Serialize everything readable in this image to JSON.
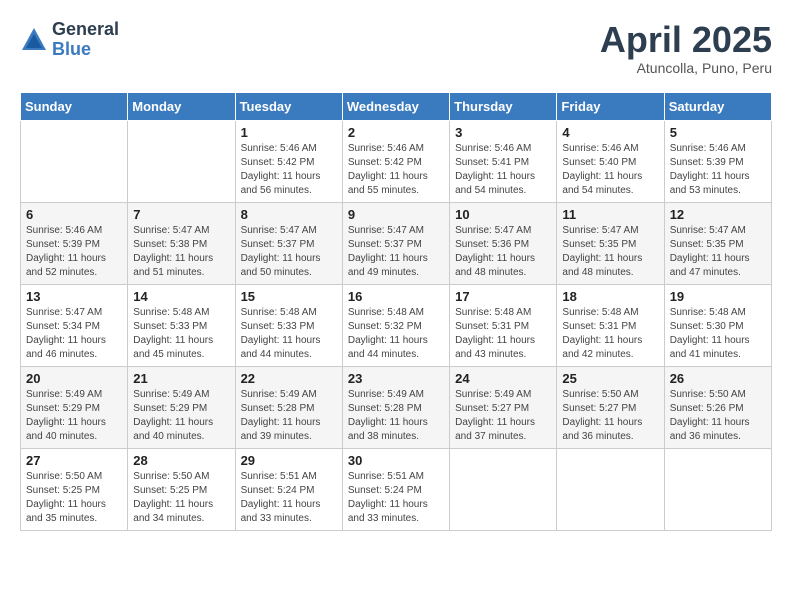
{
  "header": {
    "logo_general": "General",
    "logo_blue": "Blue",
    "month_title": "April 2025",
    "subtitle": "Atuncolla, Puno, Peru"
  },
  "days_of_week": [
    "Sunday",
    "Monday",
    "Tuesday",
    "Wednesday",
    "Thursday",
    "Friday",
    "Saturday"
  ],
  "weeks": [
    [
      {
        "day": "",
        "info": ""
      },
      {
        "day": "",
        "info": ""
      },
      {
        "day": "1",
        "info": "Sunrise: 5:46 AM\nSunset: 5:42 PM\nDaylight: 11 hours and 56 minutes."
      },
      {
        "day": "2",
        "info": "Sunrise: 5:46 AM\nSunset: 5:42 PM\nDaylight: 11 hours and 55 minutes."
      },
      {
        "day": "3",
        "info": "Sunrise: 5:46 AM\nSunset: 5:41 PM\nDaylight: 11 hours and 54 minutes."
      },
      {
        "day": "4",
        "info": "Sunrise: 5:46 AM\nSunset: 5:40 PM\nDaylight: 11 hours and 54 minutes."
      },
      {
        "day": "5",
        "info": "Sunrise: 5:46 AM\nSunset: 5:39 PM\nDaylight: 11 hours and 53 minutes."
      }
    ],
    [
      {
        "day": "6",
        "info": "Sunrise: 5:46 AM\nSunset: 5:39 PM\nDaylight: 11 hours and 52 minutes."
      },
      {
        "day": "7",
        "info": "Sunrise: 5:47 AM\nSunset: 5:38 PM\nDaylight: 11 hours and 51 minutes."
      },
      {
        "day": "8",
        "info": "Sunrise: 5:47 AM\nSunset: 5:37 PM\nDaylight: 11 hours and 50 minutes."
      },
      {
        "day": "9",
        "info": "Sunrise: 5:47 AM\nSunset: 5:37 PM\nDaylight: 11 hours and 49 minutes."
      },
      {
        "day": "10",
        "info": "Sunrise: 5:47 AM\nSunset: 5:36 PM\nDaylight: 11 hours and 48 minutes."
      },
      {
        "day": "11",
        "info": "Sunrise: 5:47 AM\nSunset: 5:35 PM\nDaylight: 11 hours and 48 minutes."
      },
      {
        "day": "12",
        "info": "Sunrise: 5:47 AM\nSunset: 5:35 PM\nDaylight: 11 hours and 47 minutes."
      }
    ],
    [
      {
        "day": "13",
        "info": "Sunrise: 5:47 AM\nSunset: 5:34 PM\nDaylight: 11 hours and 46 minutes."
      },
      {
        "day": "14",
        "info": "Sunrise: 5:48 AM\nSunset: 5:33 PM\nDaylight: 11 hours and 45 minutes."
      },
      {
        "day": "15",
        "info": "Sunrise: 5:48 AM\nSunset: 5:33 PM\nDaylight: 11 hours and 44 minutes."
      },
      {
        "day": "16",
        "info": "Sunrise: 5:48 AM\nSunset: 5:32 PM\nDaylight: 11 hours and 44 minutes."
      },
      {
        "day": "17",
        "info": "Sunrise: 5:48 AM\nSunset: 5:31 PM\nDaylight: 11 hours and 43 minutes."
      },
      {
        "day": "18",
        "info": "Sunrise: 5:48 AM\nSunset: 5:31 PM\nDaylight: 11 hours and 42 minutes."
      },
      {
        "day": "19",
        "info": "Sunrise: 5:48 AM\nSunset: 5:30 PM\nDaylight: 11 hours and 41 minutes."
      }
    ],
    [
      {
        "day": "20",
        "info": "Sunrise: 5:49 AM\nSunset: 5:29 PM\nDaylight: 11 hours and 40 minutes."
      },
      {
        "day": "21",
        "info": "Sunrise: 5:49 AM\nSunset: 5:29 PM\nDaylight: 11 hours and 40 minutes."
      },
      {
        "day": "22",
        "info": "Sunrise: 5:49 AM\nSunset: 5:28 PM\nDaylight: 11 hours and 39 minutes."
      },
      {
        "day": "23",
        "info": "Sunrise: 5:49 AM\nSunset: 5:28 PM\nDaylight: 11 hours and 38 minutes."
      },
      {
        "day": "24",
        "info": "Sunrise: 5:49 AM\nSunset: 5:27 PM\nDaylight: 11 hours and 37 minutes."
      },
      {
        "day": "25",
        "info": "Sunrise: 5:50 AM\nSunset: 5:27 PM\nDaylight: 11 hours and 36 minutes."
      },
      {
        "day": "26",
        "info": "Sunrise: 5:50 AM\nSunset: 5:26 PM\nDaylight: 11 hours and 36 minutes."
      }
    ],
    [
      {
        "day": "27",
        "info": "Sunrise: 5:50 AM\nSunset: 5:25 PM\nDaylight: 11 hours and 35 minutes."
      },
      {
        "day": "28",
        "info": "Sunrise: 5:50 AM\nSunset: 5:25 PM\nDaylight: 11 hours and 34 minutes."
      },
      {
        "day": "29",
        "info": "Sunrise: 5:51 AM\nSunset: 5:24 PM\nDaylight: 11 hours and 33 minutes."
      },
      {
        "day": "30",
        "info": "Sunrise: 5:51 AM\nSunset: 5:24 PM\nDaylight: 11 hours and 33 minutes."
      },
      {
        "day": "",
        "info": ""
      },
      {
        "day": "",
        "info": ""
      },
      {
        "day": "",
        "info": ""
      }
    ]
  ]
}
